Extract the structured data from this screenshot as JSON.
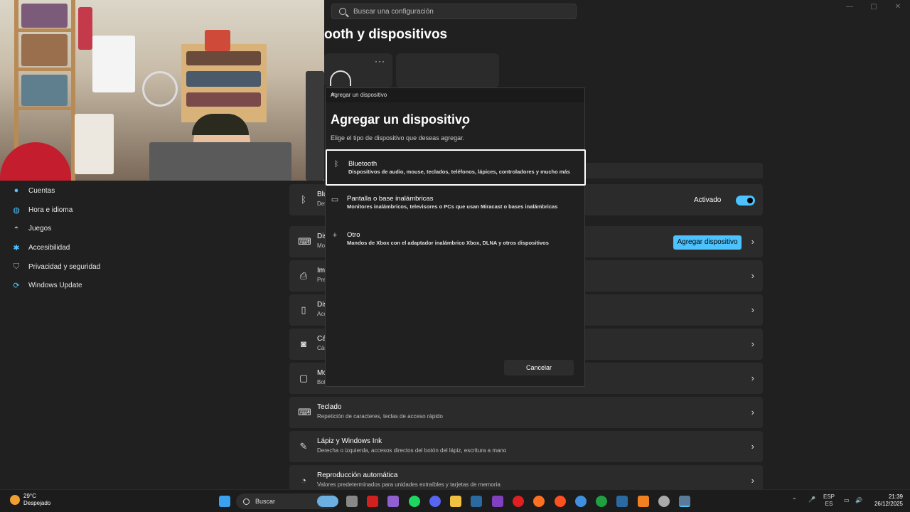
{
  "window": {
    "minimize": "—",
    "maximize": "▢",
    "close": "✕"
  },
  "search": {
    "placeholder": "Buscar una configuración"
  },
  "page_title": "ooth y dispositivos",
  "top_cards": {
    "more": "···"
  },
  "sidebar": {
    "items": [
      {
        "label": "Cuentas",
        "icon": "user-icon",
        "color": "#4cc2ff"
      },
      {
        "label": "Hora e idioma",
        "icon": "globe-icon",
        "color": "#4cc2ff"
      },
      {
        "label": "Juegos",
        "icon": "gamepad-icon",
        "color": "#aaaaaa"
      },
      {
        "label": "Accesibilidad",
        "icon": "accessibility-icon",
        "color": "#4cc2ff"
      },
      {
        "label": "Privacidad y seguridad",
        "icon": "shield-icon",
        "color": "#aaaaaa"
      },
      {
        "label": "Windows Update",
        "icon": "update-icon",
        "color": "#4cc2ff"
      }
    ]
  },
  "rows": [
    {
      "title": "Blu",
      "sub": "Det",
      "icon": "bluetooth-icon"
    },
    {
      "title": "Dis",
      "sub": "Mo",
      "icon": "devices-icon"
    },
    {
      "title": "Im",
      "sub": "Pre",
      "icon": "printer-icon"
    },
    {
      "title": "Dis",
      "sub": "Acc",
      "icon": "phone-icon"
    },
    {
      "title": "Cá",
      "sub": "Cár",
      "icon": "camera-icon"
    },
    {
      "title": "Mo",
      "sub": "Bot",
      "icon": "mouse-icon"
    },
    {
      "title": "Teclado",
      "sub": "Repetición de caracteres, teclas de acceso rápido",
      "icon": "keyboard-icon"
    },
    {
      "title": "Lápiz y Windows Ink",
      "sub": "Derecha o izquierda, accesos directos del botón del lápiz, escritura a mano",
      "icon": "pen-icon"
    },
    {
      "title": "Reproducción automática",
      "sub": "Valores predeterminados para unidades extraíbles y tarjetas de memoria",
      "icon": "autoplay-icon"
    }
  ],
  "bluetooth_toggle": {
    "label": "Activado",
    "state": "on",
    "color": "#4cc2ff"
  },
  "add_device_button": "Agregar dispositivo",
  "dialog": {
    "titlebar": "Agregar un dispositivo",
    "heading": "Agregar un dispositivo",
    "subtitle": "Elige el tipo de dispositivo que deseas agregar.",
    "options": [
      {
        "title": "Bluetooth",
        "sub": "Dispositivos de audio, mouse, teclados, teléfonos, lápices, controladores y mucho más",
        "icon": "bluetooth-icon"
      },
      {
        "title": "Pantalla o base inalámbricas",
        "sub": "Monitores inalámbricos, televisores o PCs que usan Miracast o bases inalámbricas",
        "icon": "monitor-icon"
      },
      {
        "title": "Otro",
        "sub": "Mandos de Xbox con el adaptador inalámbrico Xbox, DLNA y otros dispositivos",
        "icon": "plus-icon"
      }
    ],
    "cancel": "Cancelar"
  },
  "taskbar": {
    "weather_temp": "29°C",
    "weather_desc": "Despejado",
    "search": "Buscar",
    "lang_top": "ESP",
    "lang_bottom": "ES",
    "time": "21:39",
    "date": "26/12/2025"
  }
}
